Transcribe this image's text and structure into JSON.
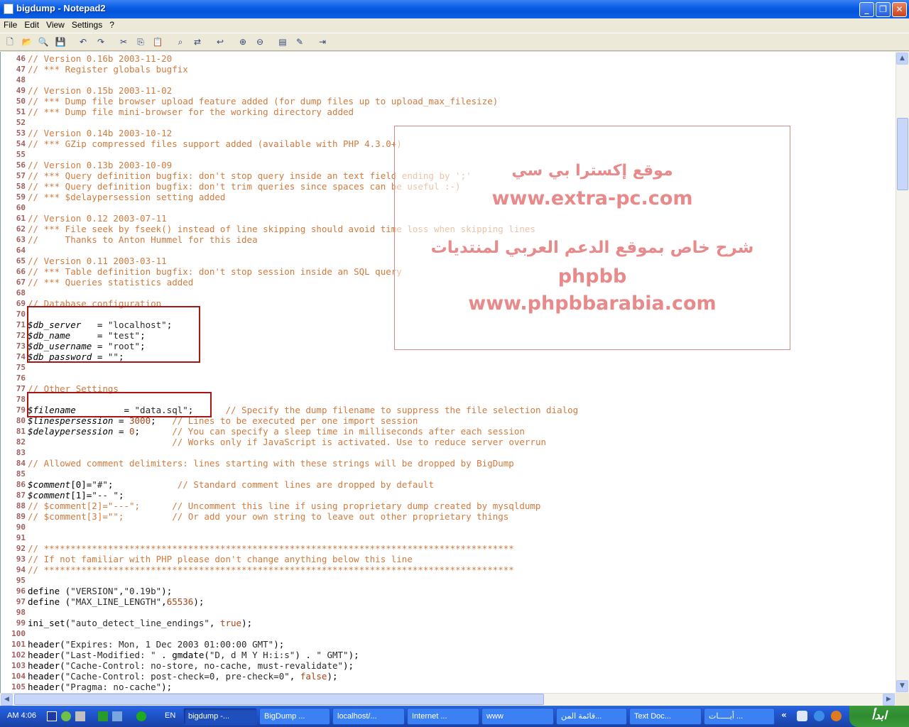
{
  "window": {
    "title": "bigdump - Notepad2"
  },
  "menu": [
    "File",
    "Edit",
    "View",
    "Settings",
    "?"
  ],
  "code": [
    {
      "n": "46",
      "t": [
        [
          "c",
          "// Version 0.16b 2003-11-20"
        ]
      ]
    },
    {
      "n": "47",
      "t": [
        [
          "c",
          "// *** Register globals bugfix"
        ]
      ]
    },
    {
      "n": "48",
      "t": []
    },
    {
      "n": "49",
      "t": [
        [
          "c",
          "// Version 0.15b 2003-11-02"
        ]
      ]
    },
    {
      "n": "50",
      "t": [
        [
          "c",
          "// *** Dump file browser upload feature added (for dump files up to upload_max_filesize)"
        ]
      ]
    },
    {
      "n": "51",
      "t": [
        [
          "c",
          "// *** Dump file mini-browser for the working directory added"
        ]
      ]
    },
    {
      "n": "52",
      "t": []
    },
    {
      "n": "53",
      "t": [
        [
          "c",
          "// Version 0.14b 2003-10-12"
        ]
      ]
    },
    {
      "n": "54",
      "t": [
        [
          "c",
          "// *** GZip compressed files support added (available with PHP 4.3.0+)"
        ]
      ]
    },
    {
      "n": "55",
      "t": []
    },
    {
      "n": "56",
      "t": [
        [
          "c",
          "// Version 0.13b 2003-10-09"
        ]
      ]
    },
    {
      "n": "57",
      "t": [
        [
          "c",
          "// *** Query definition bugfix: don't stop query inside an text field ending by ';'"
        ]
      ]
    },
    {
      "n": "58",
      "t": [
        [
          "c",
          "// *** Query definition bugfix: don't trim queries since spaces can be useful :-)"
        ]
      ]
    },
    {
      "n": "59",
      "t": [
        [
          "c",
          "// *** $delaypersession setting added"
        ]
      ]
    },
    {
      "n": "60",
      "t": []
    },
    {
      "n": "61",
      "t": [
        [
          "c",
          "// Version 0.12 2003-07-11"
        ]
      ]
    },
    {
      "n": "62",
      "t": [
        [
          "c",
          "// *** File seek by fseek() instead of line skipping should avoid time loss when skipping lines"
        ]
      ]
    },
    {
      "n": "63",
      "t": [
        [
          "c",
          "//     Thanks to Anton Hummel for this idea"
        ]
      ]
    },
    {
      "n": "64",
      "t": []
    },
    {
      "n": "65",
      "t": [
        [
          "c",
          "// Version 0.11 2003-03-11"
        ]
      ]
    },
    {
      "n": "66",
      "t": [
        [
          "c",
          "// *** Table definition bugfix: don't stop session inside an SQL query"
        ]
      ]
    },
    {
      "n": "67",
      "t": [
        [
          "c",
          "// *** Queries statistics added"
        ]
      ]
    },
    {
      "n": "68",
      "t": []
    },
    {
      "n": "69",
      "t": [
        [
          "c",
          "// Database configuration"
        ]
      ]
    },
    {
      "n": "70",
      "t": []
    },
    {
      "n": "71",
      "t": [
        [
          "v",
          "$db_server"
        ],
        [
          "k",
          "   = "
        ],
        [
          "s",
          "\"localhost\""
        ],
        [
          "k",
          ";"
        ]
      ]
    },
    {
      "n": "72",
      "t": [
        [
          "v",
          "$db_name"
        ],
        [
          "k",
          "     = "
        ],
        [
          "s",
          "\"test\""
        ],
        [
          "k",
          ";"
        ]
      ]
    },
    {
      "n": "73",
      "t": [
        [
          "v",
          "$db_username"
        ],
        [
          "k",
          " = "
        ],
        [
          "s",
          "\"root\""
        ],
        [
          "k",
          ";"
        ]
      ]
    },
    {
      "n": "74",
      "t": [
        [
          "v",
          "$db_password"
        ],
        [
          "k",
          " = "
        ],
        [
          "s",
          "\"\""
        ],
        [
          "k",
          ";"
        ]
      ]
    },
    {
      "n": "75",
      "t": []
    },
    {
      "n": "76",
      "t": []
    },
    {
      "n": "77",
      "t": [
        [
          "c",
          "// Other Settings"
        ]
      ]
    },
    {
      "n": "78",
      "t": []
    },
    {
      "n": "79",
      "t": [
        [
          "v",
          "$filename"
        ],
        [
          "k",
          "         = "
        ],
        [
          "s",
          "\"data.sql\""
        ],
        [
          "k",
          ";      "
        ],
        [
          "c",
          "// Specify the dump filename to suppress the file selection dialog"
        ]
      ]
    },
    {
      "n": "80",
      "t": [
        [
          "v",
          "$linespersession"
        ],
        [
          "k",
          " = "
        ],
        [
          "n",
          "3000"
        ],
        [
          "k",
          ";   "
        ],
        [
          "c",
          "// Lines to be executed per one import session"
        ]
      ]
    },
    {
      "n": "81",
      "t": [
        [
          "v",
          "$delaypersession"
        ],
        [
          "k",
          " = "
        ],
        [
          "n",
          "0"
        ],
        [
          "k",
          ";      "
        ],
        [
          "c",
          "// You can specify a sleep time in milliseconds after each session"
        ]
      ]
    },
    {
      "n": "82",
      "t": [
        [
          "k",
          "                           "
        ],
        [
          "c",
          "// Works only if JavaScript is activated. Use to reduce server overrun"
        ]
      ]
    },
    {
      "n": "83",
      "t": []
    },
    {
      "n": "84",
      "t": [
        [
          "c",
          "// Allowed comment delimiters: lines starting with these strings will be dropped by BigDump"
        ]
      ]
    },
    {
      "n": "85",
      "t": []
    },
    {
      "n": "86",
      "t": [
        [
          "v",
          "$comment"
        ],
        [
          "k",
          "[0]="
        ],
        [
          "s",
          "\"#\""
        ],
        [
          "k",
          ";            "
        ],
        [
          "c",
          "// Standard comment lines are dropped by default"
        ]
      ]
    },
    {
      "n": "87",
      "t": [
        [
          "v",
          "$comment"
        ],
        [
          "k",
          "[1]="
        ],
        [
          "s",
          "\"-- \""
        ],
        [
          "k",
          ";"
        ]
      ]
    },
    {
      "n": "88",
      "t": [
        [
          "c",
          "// $comment[2]=\"---\";      // Uncomment this line if using proprietary dump created by mysqldump"
        ]
      ]
    },
    {
      "n": "89",
      "t": [
        [
          "c",
          "// $comment[3]=\"\";         // Or add your own string to leave out other proprietary things"
        ]
      ]
    },
    {
      "n": "90",
      "t": []
    },
    {
      "n": "91",
      "t": []
    },
    {
      "n": "92",
      "t": [
        [
          "c",
          "// ****************************************************************************************"
        ]
      ]
    },
    {
      "n": "93",
      "t": [
        [
          "c",
          "// If not familiar with PHP please don't change anything below this line"
        ]
      ]
    },
    {
      "n": "94",
      "t": [
        [
          "c",
          "// ****************************************************************************************"
        ]
      ]
    },
    {
      "n": "95",
      "t": []
    },
    {
      "n": "96",
      "t": [
        [
          "k",
          "define ("
        ],
        [
          "s",
          "\"VERSION\""
        ],
        [
          "k",
          ","
        ],
        [
          "s",
          "\"0.19b\""
        ],
        [
          "k",
          ");"
        ]
      ]
    },
    {
      "n": "97",
      "t": [
        [
          "k",
          "define ("
        ],
        [
          "s",
          "\"MAX_LINE_LENGTH\""
        ],
        [
          "k",
          ","
        ],
        [
          "n",
          "65536"
        ],
        [
          "k",
          ");"
        ]
      ]
    },
    {
      "n": "98",
      "t": []
    },
    {
      "n": "99",
      "t": [
        [
          "k",
          "ini_set("
        ],
        [
          "s",
          "\"auto_detect_line_endings\""
        ],
        [
          "k",
          ", "
        ],
        [
          "n",
          "true"
        ],
        [
          "k",
          ");"
        ]
      ]
    },
    {
      "n": "100",
      "t": []
    },
    {
      "n": "101",
      "t": [
        [
          "k",
          "header("
        ],
        [
          "s",
          "\"Expires: Mon, 1 Dec 2003 01:00:00 GMT\""
        ],
        [
          "k",
          ");"
        ]
      ]
    },
    {
      "n": "102",
      "t": [
        [
          "k",
          "header("
        ],
        [
          "s",
          "\"Last-Modified: \""
        ],
        [
          "k",
          " . gmdate("
        ],
        [
          "s",
          "\"D, d M Y H:i:s\""
        ],
        [
          "k",
          ") . "
        ],
        [
          "s",
          "\" GMT\""
        ],
        [
          "k",
          ");"
        ]
      ]
    },
    {
      "n": "103",
      "t": [
        [
          "k",
          "header("
        ],
        [
          "s",
          "\"Cache-Control: no-store, no-cache, must-revalidate\""
        ],
        [
          "k",
          ");"
        ]
      ]
    },
    {
      "n": "104",
      "t": [
        [
          "k",
          "header("
        ],
        [
          "s",
          "\"Cache-Control: post-check=0, pre-check=0\""
        ],
        [
          "k",
          ", "
        ],
        [
          "n",
          "false"
        ],
        [
          "k",
          ");"
        ]
      ]
    },
    {
      "n": "105",
      "t": [
        [
          "k",
          "header("
        ],
        [
          "s",
          "\"Pragma: no-cache\""
        ],
        [
          "k",
          ");"
        ]
      ]
    }
  ],
  "overlay": {
    "line1": "موقع إكسترا بي سي",
    "line2": "www.extra-pc.com",
    "line3": "شرح خاص بموقع الدعم العربي لمنتديات",
    "line4": "phpbb",
    "line5": "www.phpbbarabia.com"
  },
  "taskbar": {
    "clock": "AM 4:06",
    "lang": "EN",
    "start": "ابدأ",
    "tasks": [
      {
        "label": "bigdump -...",
        "active": true
      },
      {
        "label": "BigDump ...",
        "active": false
      },
      {
        "label": "localhost/...",
        "active": false
      },
      {
        "label": "Internet ...",
        "active": false
      },
      {
        "label": "www",
        "active": false
      },
      {
        "label": "قائمة المن...",
        "active": false
      },
      {
        "label": "Text Doc...",
        "active": false
      },
      {
        "label": "أيـــــات ...",
        "active": false
      }
    ]
  }
}
